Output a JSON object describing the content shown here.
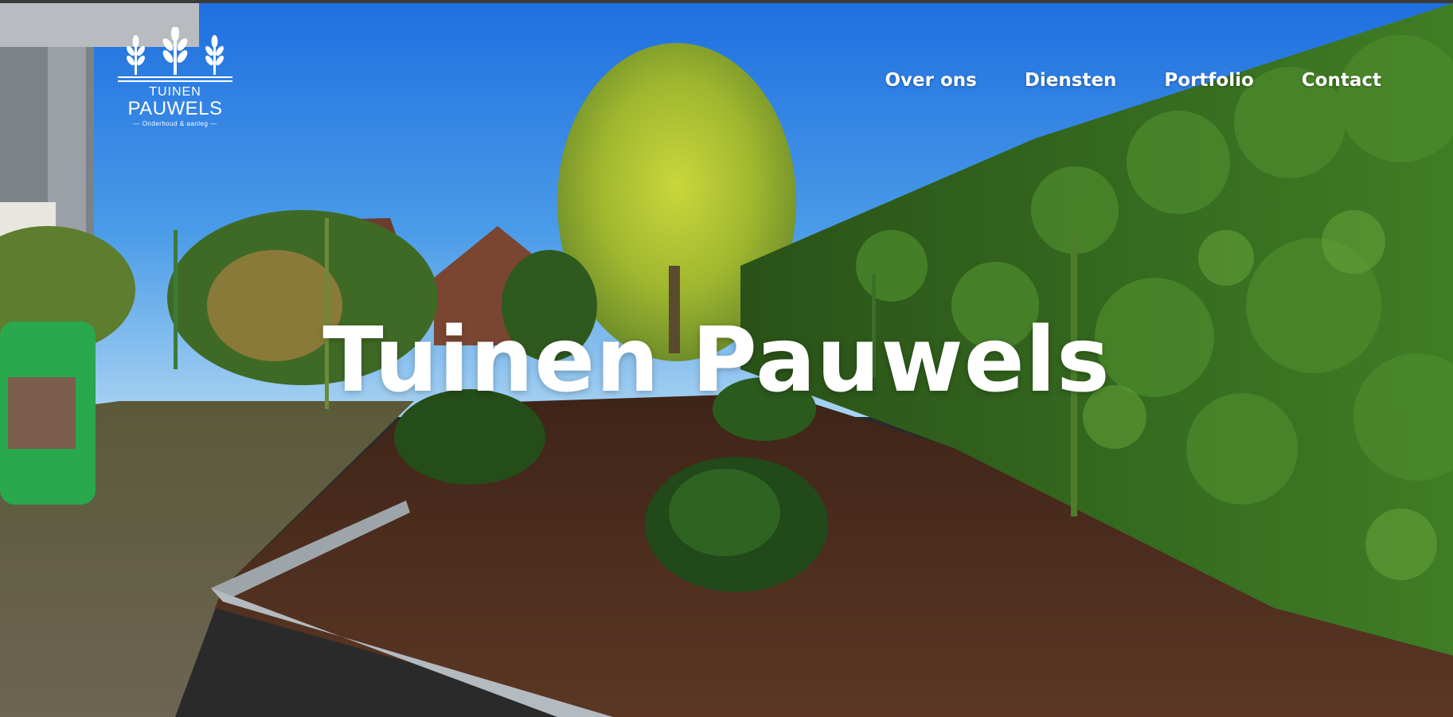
{
  "logo": {
    "word_1": "TUINEN",
    "word_2": "PAUWELS",
    "tagline": "— Onderhoud & aanleg —"
  },
  "nav": {
    "items": [
      {
        "label": "Over ons"
      },
      {
        "label": "Diensten"
      },
      {
        "label": "Portfolio"
      },
      {
        "label": "Contact"
      }
    ]
  },
  "hero": {
    "title": "Tuinen Pauwels",
    "photo": "garden-bed-with-hedge-photo"
  },
  "colors": {
    "sky_top": "#1f7be6",
    "sky_bottom": "#8cc4f2",
    "hedge": "#2f6a1e",
    "mulch": "#4a2c1c",
    "text": "#ffffff"
  }
}
